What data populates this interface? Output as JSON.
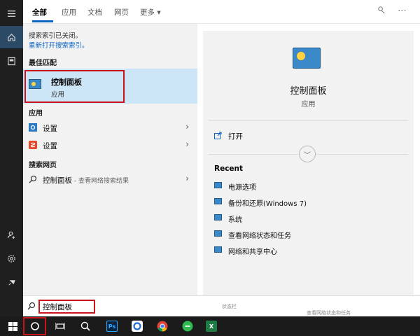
{
  "tabs": [
    "全部",
    "应用",
    "文档",
    "网页",
    "更多"
  ],
  "more_arrow": "▾",
  "left": {
    "notice": "搜索索引已关闭。",
    "notice_link": "重新打开搜索索引。",
    "best_match_heading": "最佳匹配",
    "best_match_title": "控制面板",
    "best_match_subtitle": "应用",
    "apps_heading": "应用",
    "apps": [
      {
        "label": "设置"
      },
      {
        "label": "设置"
      }
    ],
    "web_heading": "搜索网页",
    "web_result_title": "控制面板",
    "web_result_sub": " - 查看网络搜索结果"
  },
  "preview": {
    "title": "控制面板",
    "subtitle": "应用",
    "open_label": "打开",
    "recent_heading": "Recent",
    "recent": [
      "电源选项",
      "备份和还原(Windows 7)",
      "系统",
      "查看网络状态和任务",
      "网络和共享中心"
    ]
  },
  "search": {
    "value": "控制面板",
    "ghost_left": "状态栏",
    "ghost_right": "查看网络状态和任务"
  },
  "taskbar": {
    "ps_label": "Ps",
    "excel_label": "X"
  },
  "colors": {
    "accent": "#0a64c2",
    "highlight_outline": "#c9141c",
    "best_match_bg": "#cde6f7",
    "taskbar_bg": "#1b1b1b"
  }
}
